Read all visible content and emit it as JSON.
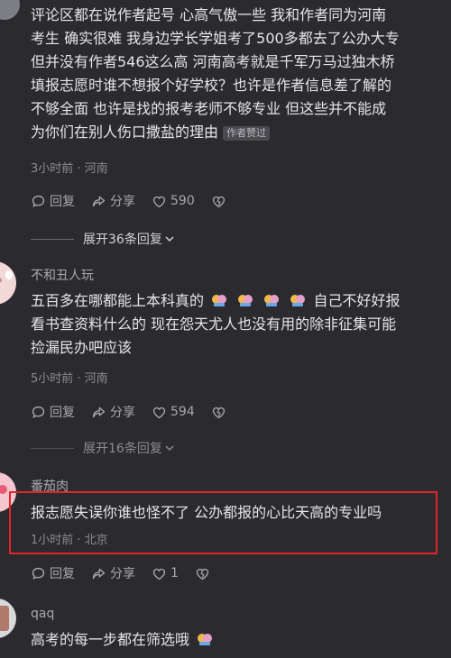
{
  "comment1": {
    "lines": [
      "评论区都在说作者起号 心高气傲一些  我和作者同为河南",
      "考生 确实很难 我身边学长学姐考了500多都去了公办大专",
      "但并没有作者546这么高 河南高考就是千军万马过独木桥",
      "填报志愿时谁不想报个好学校？也许是作者信息差了解的",
      "不够全面  也许是找的报考老师不够专业 但这些并不能成",
      "为你们在别人伤口撒盐的理由"
    ],
    "badge": "作者赞过",
    "meta": "3小时前 · 河南",
    "actions": {
      "reply": "回复",
      "share": "分享",
      "likes": "590"
    },
    "expand": "展开36条回复"
  },
  "comment2": {
    "username": "不和丑人玩",
    "line1_text": "五百多在哪都能上本科真的",
    "line1_tail": "自己不好好报",
    "lines": [
      "看书查资料什么的 现在怨天尤人也没有用的除非征集可能",
      "捡漏民办吧应该"
    ],
    "meta": "5小时前 · 河南",
    "actions": {
      "reply": "回复",
      "share": "分享",
      "likes": "594"
    },
    "expand": "展开16条回复"
  },
  "comment3": {
    "username": "番茄肉",
    "text": "报志愿失误你谁也怪不了 公办都报的心比天高的专业吗",
    "meta": "1小时前 · 北京",
    "actions": {
      "reply": "回复",
      "share": "分享",
      "likes": "1"
    }
  },
  "comment4": {
    "username": "qaq",
    "text": "高考的每一步都在筛选哦"
  },
  "colors": {
    "background": "#2b2b2f",
    "highlight": "#e0242a"
  },
  "icons": [
    "comment-icon",
    "share-icon",
    "heart-icon",
    "dislike-heart-icon",
    "chevron-down-icon",
    "cheers-emoji"
  ]
}
